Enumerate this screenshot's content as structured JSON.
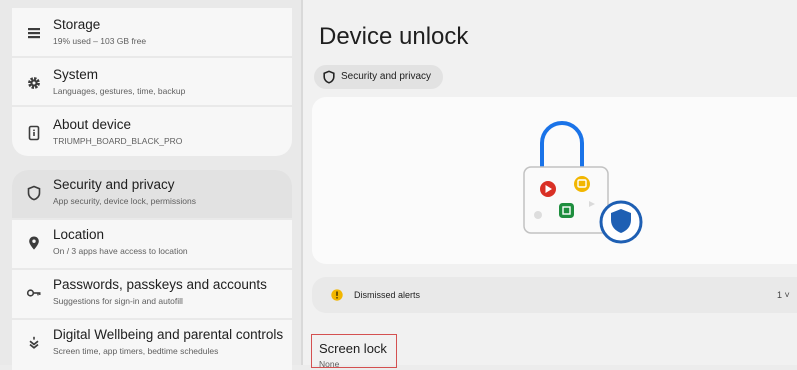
{
  "sidebar": {
    "items": [
      {
        "title": "Storage",
        "subtitle": "19% used – 103 GB free",
        "icon": "storage-icon"
      },
      {
        "title": "System",
        "subtitle": "Languages, gestures, time, backup",
        "icon": "gear-icon"
      },
      {
        "title": "About device",
        "subtitle": "TRIUMPH_BOARD_BLACK_PRO",
        "icon": "device-info-icon"
      },
      {
        "title": "Security and privacy",
        "subtitle": "App security, device lock, permissions",
        "icon": "shield-icon",
        "selected": true
      },
      {
        "title": "Location",
        "subtitle": "On / 3 apps have access to location",
        "icon": "location-pin-icon"
      },
      {
        "title": "Passwords, passkeys and accounts",
        "subtitle": "Suggestions for sign-in and autofill",
        "icon": "key-icon"
      },
      {
        "title": "Digital Wellbeing and parental controls",
        "subtitle": "Screen time, app timers, bedtime schedules",
        "icon": "wellbeing-icon"
      }
    ]
  },
  "main": {
    "title": "Device unlock",
    "breadcrumb_chip": {
      "label": "Security and privacy",
      "icon": "shield-icon"
    },
    "alerts": {
      "label": "Dismissed alerts",
      "count": "1 ˅",
      "icon": "warning-icon"
    },
    "screen_lock": {
      "title": "Screen lock",
      "subtitle": "None"
    }
  },
  "colors": {
    "accent_blue": "#1a73e8",
    "shield_blue": "#1e5fb3",
    "selected_bg": "#e2e2e2",
    "highlight_border": "#d45050",
    "warning_yellow": "#f2b600"
  }
}
